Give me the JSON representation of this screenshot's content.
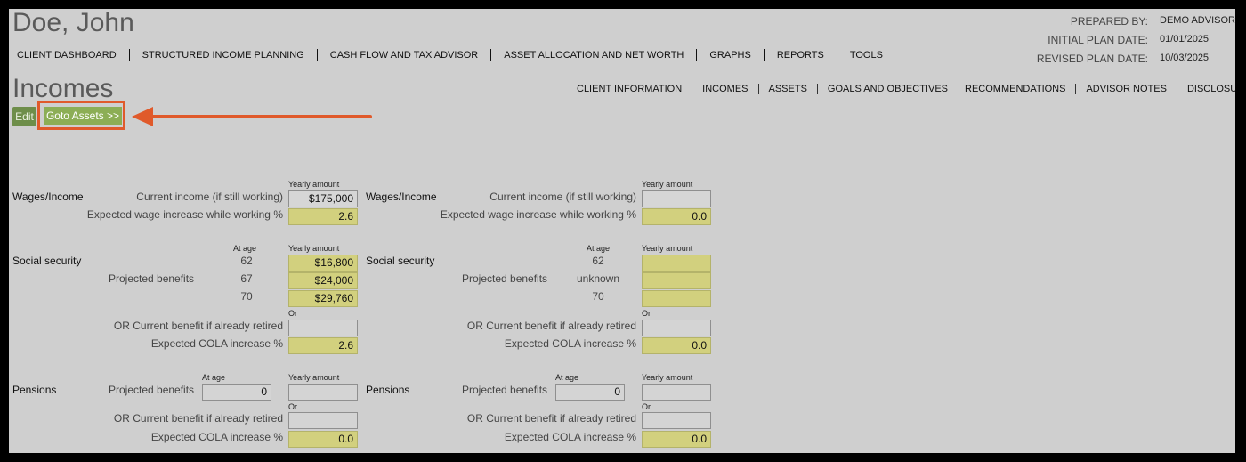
{
  "client": {
    "name": "Doe, John"
  },
  "plan_info": {
    "prepared_by_label": "PREPARED BY:",
    "prepared_by": "DEMO ADVISOR",
    "initial_label": "INITIAL PLAN DATE:",
    "initial_date": "01/01/2025",
    "revised_label": "REVISED PLAN DATE:",
    "revised_date": "10/03/2025"
  },
  "main_nav": [
    "CLIENT DASHBOARD",
    "STRUCTURED INCOME PLANNING",
    "CASH FLOW AND TAX ADVISOR",
    "ASSET ALLOCATION AND NET WORTH",
    "GRAPHS",
    "REPORTS",
    "TOOLS"
  ],
  "page_title": "Incomes",
  "sub_nav_left": [
    "CLIENT INFORMATION",
    "INCOMES",
    "ASSETS",
    "GOALS AND OBJECTIVES"
  ],
  "sub_nav_right": [
    "RECOMMENDATIONS",
    "ADVISOR NOTES",
    "DISCLOSURE"
  ],
  "buttons": {
    "edit": "Edit",
    "goto_assets": "Goto Assets >>"
  },
  "annotation_color": "#e05a2b",
  "columns": [
    {
      "wages": {
        "section": "Wages/Income",
        "caption": "Yearly amount",
        "current_label": "Current income (if still working)",
        "current_value": "$175,000",
        "increase_label": "Expected wage increase while working %",
        "increase_value": "2.6"
      },
      "ss": {
        "section": "Social security",
        "at_age_caption": "At age",
        "yearly_caption": "Yearly amount",
        "projected_label": "Projected benefits",
        "ages": [
          "62",
          "67",
          "70"
        ],
        "values": [
          "$16,800",
          "$24,000",
          "$29,760"
        ],
        "or_caption": "Or",
        "retired_label": "OR Current benefit if already retired",
        "retired_value": "",
        "cola_label": "Expected COLA increase %",
        "cola_value": "2.6"
      },
      "pensions": {
        "section": "Pensions",
        "at_age_caption": "At age",
        "yearly_caption": "Yearly amount",
        "projected_label": "Projected benefits",
        "age_value": "0",
        "yearly_value": "",
        "or_caption": "Or",
        "retired_label": "OR Current benefit if already retired",
        "retired_value": "",
        "cola_label": "Expected COLA increase %",
        "cola_value": "0.0"
      }
    },
    {
      "wages": {
        "section": "Wages/Income",
        "caption": "Yearly amount",
        "current_label": "Current income (if still working)",
        "current_value": "",
        "increase_label": "Expected wage increase while working %",
        "increase_value": "0.0"
      },
      "ss": {
        "section": "Social security",
        "at_age_caption": "At age",
        "yearly_caption": "Yearly amount",
        "projected_label": "Projected benefits",
        "ages": [
          "62",
          "unknown",
          "70"
        ],
        "values": [
          "",
          "",
          ""
        ],
        "or_caption": "Or",
        "retired_label": "OR Current benefit if already retired",
        "retired_value": "",
        "cola_label": "Expected COLA increase %",
        "cola_value": "0.0"
      },
      "pensions": {
        "section": "Pensions",
        "at_age_caption": "At age",
        "yearly_caption": "Yearly amount",
        "projected_label": "Projected benefits",
        "age_value": "0",
        "yearly_value": "",
        "or_caption": "Or",
        "retired_label": "OR Current benefit if already retired",
        "retired_value": "",
        "cola_label": "Expected COLA increase %",
        "cola_value": "0.0"
      }
    }
  ]
}
